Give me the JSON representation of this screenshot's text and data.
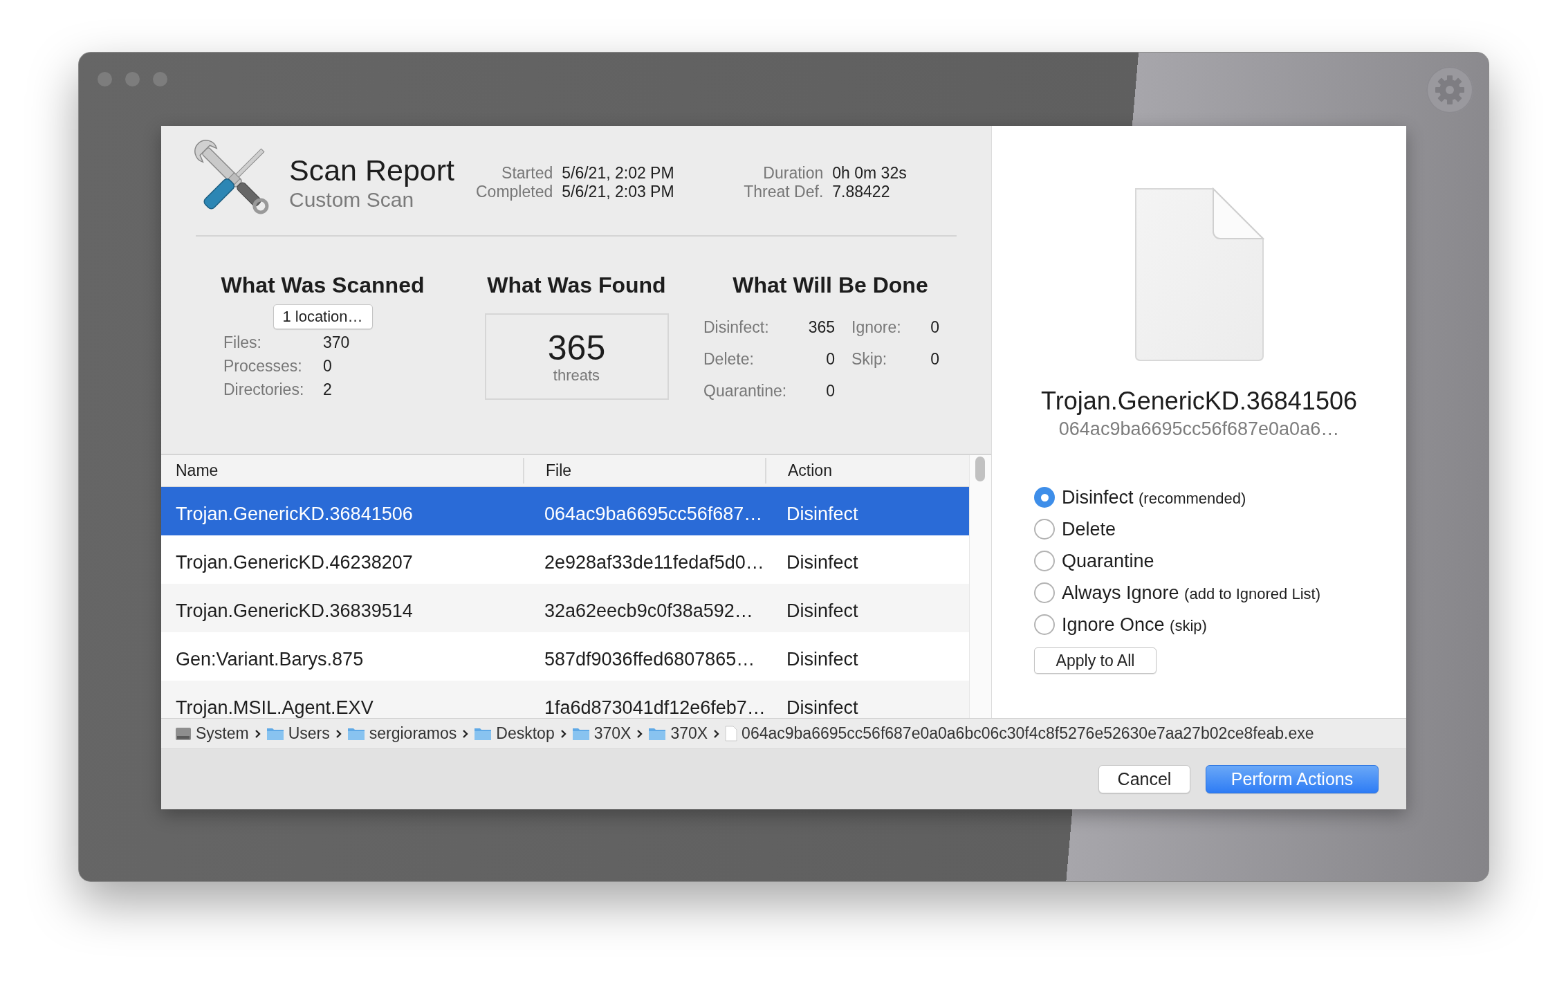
{
  "header": {
    "title": "Scan Report",
    "subtitle": "Custom Scan",
    "meta": [
      {
        "label": "Started",
        "value": "5/6/21, 2:02 PM"
      },
      {
        "label": "Duration",
        "value": "0h 0m 32s"
      },
      {
        "label": "Completed",
        "value": "5/6/21, 2:03 PM"
      },
      {
        "label": "Threat Def.",
        "value": "7.88422"
      }
    ]
  },
  "scanned": {
    "heading": "What Was Scanned",
    "button": "1 location…",
    "stats": [
      {
        "label": "Files:",
        "value": "370"
      },
      {
        "label": "Processes:",
        "value": "0"
      },
      {
        "label": "Directories:",
        "value": "2"
      }
    ]
  },
  "found": {
    "heading": "What Was Found",
    "count": "365",
    "unit": "threats"
  },
  "done": {
    "heading": "What Will Be Done",
    "stats": [
      {
        "label": "Disinfect:",
        "value": "365"
      },
      {
        "label": "Ignore:",
        "value": "0"
      },
      {
        "label": "Delete:",
        "value": "0"
      },
      {
        "label": "Skip:",
        "value": "0"
      },
      {
        "label": "Quarantine:",
        "value": "0"
      }
    ]
  },
  "table": {
    "columns": [
      "Name",
      "File",
      "Action"
    ],
    "rows": [
      {
        "name": "Trojan.GenericKD.36841506",
        "file": "064ac9ba6695cc56f687…",
        "action": "Disinfect",
        "selected": true
      },
      {
        "name": "Trojan.GenericKD.46238207",
        "file": "2e928af33de11fedaf5d0…",
        "action": "Disinfect",
        "selected": false
      },
      {
        "name": "Trojan.GenericKD.36839514",
        "file": "32a62eecb9c0f38a592…",
        "action": "Disinfect",
        "selected": false
      },
      {
        "name": "Gen:Variant.Barys.875",
        "file": "587df9036ffed6807865…",
        "action": "Disinfect",
        "selected": false
      },
      {
        "name": "Trojan.MSIL.Agent.EXV",
        "file": "1fa6d873041df12e6feb7…",
        "action": "Disinfect",
        "selected": false
      }
    ]
  },
  "details": {
    "name": "Trojan.GenericKD.36841506",
    "hash": "064ac9ba6695cc56f687e0a0a6…",
    "options": [
      {
        "label": "Disinfect",
        "note": "(recommended)",
        "selected": true
      },
      {
        "label": "Delete",
        "selected": false
      },
      {
        "label": "Quarantine",
        "selected": false
      },
      {
        "label": "Always Ignore",
        "note": "(add to Ignored List)",
        "selected": false
      },
      {
        "label": "Ignore Once",
        "note": "(skip)",
        "selected": false
      }
    ],
    "apply_button": "Apply to All"
  },
  "breadcrumb": [
    {
      "label": "System",
      "kind": "disk"
    },
    {
      "label": "Users",
      "kind": "folder"
    },
    {
      "label": "sergioramos",
      "kind": "folder"
    },
    {
      "label": "Desktop",
      "kind": "folder"
    },
    {
      "label": "370X",
      "kind": "folder"
    },
    {
      "label": "370X",
      "kind": "folder"
    },
    {
      "label": "064ac9ba6695cc56f687e0a0a6bc06c30f4c8f5276e52630e7aa27b02ce8feab.exe",
      "kind": "file"
    }
  ],
  "buttons": [
    {
      "label": "Cancel",
      "kind": "default"
    },
    {
      "label": "Perform Actions",
      "kind": "primary"
    }
  ]
}
